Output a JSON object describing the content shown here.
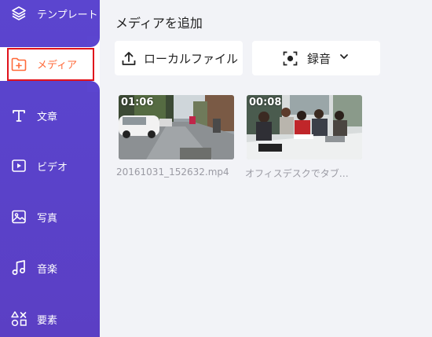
{
  "sidebar": {
    "items": [
      {
        "label": "テンプレート",
        "icon": "layers-icon"
      },
      {
        "label": "メディア",
        "icon": "folder-plus-icon"
      },
      {
        "label": "文章",
        "icon": "text-icon"
      },
      {
        "label": "ビデオ",
        "icon": "video-icon"
      },
      {
        "label": "写真",
        "icon": "image-icon"
      },
      {
        "label": "音楽",
        "icon": "music-icon"
      },
      {
        "label": "要素",
        "icon": "elements-icon"
      }
    ],
    "active_index": 1
  },
  "main": {
    "title": "メディアを追加",
    "local_file_label": "ローカルファイル",
    "record_label": "録音",
    "media": [
      {
        "duration": "01:06",
        "filename": "20161031_152632.mp4"
      },
      {
        "duration": "00:08",
        "filename": "オフィスデスクでタブ…"
      }
    ]
  },
  "colors": {
    "sidebar": "#5b45cf",
    "active_text": "#ff6a3a",
    "highlight_border": "#e0121b"
  }
}
